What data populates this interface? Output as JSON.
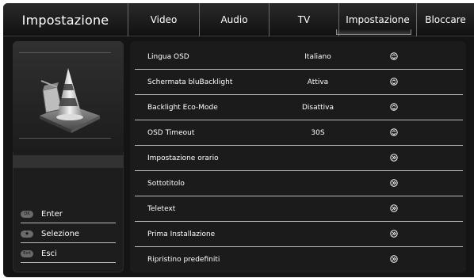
{
  "header": {
    "title": "Impostazione",
    "tabs": [
      {
        "label": "Video",
        "active": false
      },
      {
        "label": "Audio",
        "active": false
      },
      {
        "label": "TV",
        "active": false
      },
      {
        "label": "Impostazione",
        "active": true
      },
      {
        "label": "Bloccare",
        "active": false
      }
    ]
  },
  "sidebar": {
    "logo_icon": "vlc-cone-icon",
    "legend": [
      {
        "key_label": "OK",
        "label": "Enter",
        "icon": "ok-key-icon"
      },
      {
        "key_label": "◆",
        "label": "Selezione",
        "icon": "dpad-key-icon"
      },
      {
        "key_label": "Exit",
        "label": "Esci",
        "icon": "exit-key-icon"
      }
    ]
  },
  "settings": {
    "rows": [
      {
        "label": "Lingua OSD",
        "value": "Italiano",
        "icon": "up-down-arrows-icon"
      },
      {
        "label": "Schermata bluBacklight",
        "value": "Attiva",
        "icon": "up-down-arrows-icon"
      },
      {
        "label": "Backlight Eco-Mode",
        "value": "Disattiva",
        "icon": "up-down-arrows-icon"
      },
      {
        "label": "OSD Timeout",
        "value": "30S",
        "icon": "up-down-arrows-icon"
      },
      {
        "label": "Impostazione orario",
        "value": "",
        "icon": "chevron-right-icon"
      },
      {
        "label": "Sottotitolo",
        "value": "",
        "icon": "chevron-right-icon"
      },
      {
        "label": "Teletext",
        "value": "",
        "icon": "chevron-right-icon"
      },
      {
        "label": "Prima Installazione",
        "value": "",
        "icon": "chevron-right-icon"
      },
      {
        "label": "Ripristino predefiniti",
        "value": "",
        "icon": "chevron-right-icon"
      }
    ]
  },
  "colors": {
    "background": "#141414",
    "panel": "#1b1b1b",
    "text": "#ffffff",
    "separator": "#bcbcbc"
  }
}
